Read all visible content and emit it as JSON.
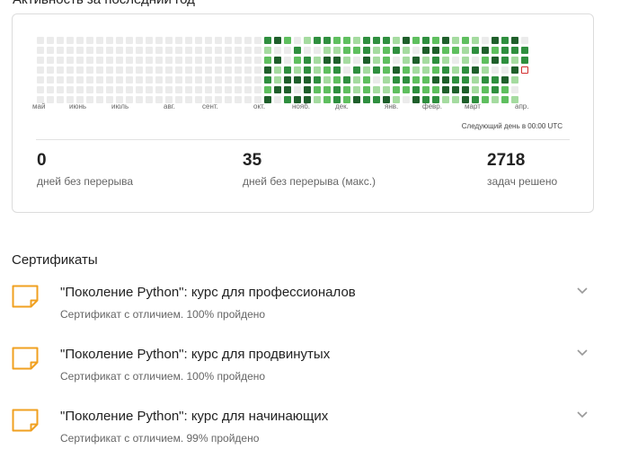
{
  "activity": {
    "title": "Активность за последний год",
    "months": [
      "май",
      "июнь",
      "июль",
      "авг.",
      "сент.",
      "окт.",
      "нояб.",
      "дек.",
      "янв.",
      "февр.",
      "март",
      "апр."
    ],
    "next_day_note": "Следующий день в 00:00 UTC",
    "colors": {
      "empty": "#ebebeb",
      "level1": "#a5dba0",
      "level2": "#5fbf5f",
      "level3": "#2f8f3f",
      "level4": "#1f5f2b",
      "today_border": "#d32f2f"
    },
    "weeks": 50,
    "active_from_week": 23,
    "stats": [
      {
        "value": "0",
        "label": "дней без перерыва"
      },
      {
        "value": "35",
        "label": "дней без перерыва (макс.)"
      },
      {
        "value": "2718",
        "label": "задач решено"
      }
    ]
  },
  "certificates": {
    "title": "Сертификаты",
    "items": [
      {
        "title": "\"Поколение Python\": курс для профессионалов",
        "subtitle": "Сертификат с отличием. 100% пройдено"
      },
      {
        "title": "\"Поколение Python\": курс для продвинутых",
        "subtitle": "Сертификат с отличием. 100% пройдено"
      },
      {
        "title": "\"Поколение Python\": курс для начинающих",
        "subtitle": "Сертификат с отличием. 99% пройдено"
      }
    ],
    "accent_color": "#f0a020"
  }
}
